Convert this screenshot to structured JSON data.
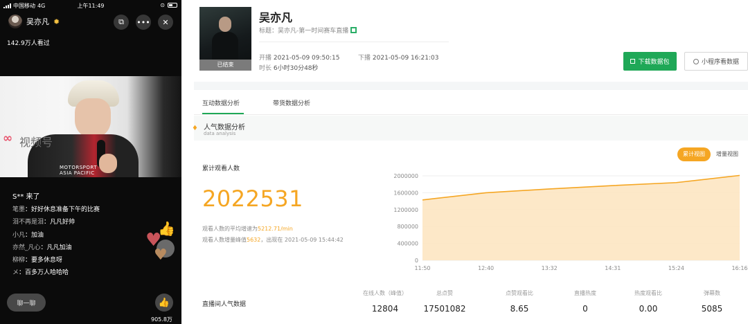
{
  "phone": {
    "status": {
      "carrier": "中国移动",
      "network": "4G",
      "time": "上午11:49"
    },
    "host": {
      "name": "吴亦凡"
    },
    "watch_count": "142.9万人看过",
    "video": {
      "watermark": "视频号",
      "jacket": "MOTORSPORT",
      "jacket2": "ASIA PACIFIC"
    },
    "comments": [
      {
        "name": "",
        "text": "S** 来了",
        "first": true
      },
      {
        "name": "笔墨",
        "text": "：好好休息准备下午的比赛"
      },
      {
        "name": "泪不再是泪",
        "text": "：凡凡好帅"
      },
      {
        "name": "小凡",
        "text": "：加油"
      },
      {
        "name": "亦然_凡心",
        "text": "：凡凡加油"
      },
      {
        "name": "柳柳",
        "text": "：要多休息呀"
      },
      {
        "name": "メ",
        "text": "：百多万人哈哈哈"
      }
    ],
    "chat_btn": "聊一聊",
    "like_count": "905.8万"
  },
  "dashboard": {
    "cover_badge": "已结束",
    "title": "吴亦凡",
    "subtitle": "标题：吴亦凡-第一时间赛车直播",
    "start_label": "开播",
    "start_value": "2021-05-09 09:50:15",
    "end_label": "下播",
    "end_value": "2021-05-09 16:21:03",
    "duration_label": "时长",
    "duration_value": "6小时30分48秒",
    "btn_download": "下载数据包",
    "btn_mini": "小程序看数据",
    "tabs": [
      "互动数据分析",
      "带货数据分析"
    ],
    "section_title": "人气数据分析",
    "section_sub": "data analysis",
    "toggle": [
      "累计视图",
      "增量视图"
    ],
    "metric_label": "累计观看人数",
    "metric_value": "2022531",
    "rate_prefix": "观看人数的平均增速为",
    "rate_value": "5212.71/min",
    "peak_prefix": "观看人数增量峰值",
    "peak_value": "5632",
    "peak_suffix": "，出现在 2021-05-09 15:44:42",
    "footer_label": "直播间人气数据",
    "stats": [
      {
        "label": "在线人数（峰值）",
        "value": "12804"
      },
      {
        "label": "总点赞",
        "value": "17501082"
      },
      {
        "label": "点赞观看比",
        "value": "8.65"
      },
      {
        "label": "直播热度",
        "value": "0"
      },
      {
        "label": "热度观看比",
        "value": "0.00"
      },
      {
        "label": "弹幕数",
        "value": "5085"
      }
    ]
  },
  "chart_data": {
    "type": "area",
    "x": [
      "11:50",
      "12:40",
      "13:32",
      "14:31",
      "15:24",
      "16:16"
    ],
    "values": [
      1430000,
      1600000,
      1690000,
      1770000,
      1840000,
      2010000
    ],
    "ylim": [
      0,
      2000000
    ],
    "yticks": [
      0,
      400000,
      800000,
      1200000,
      1600000,
      2000000
    ],
    "ytick_labels": [
      "0",
      "400000",
      "800000",
      "1200000",
      "1600000",
      "2000000"
    ],
    "colors": {
      "line": "#f5a623",
      "fill": "#fde6c2"
    },
    "grid": "horizontal"
  }
}
